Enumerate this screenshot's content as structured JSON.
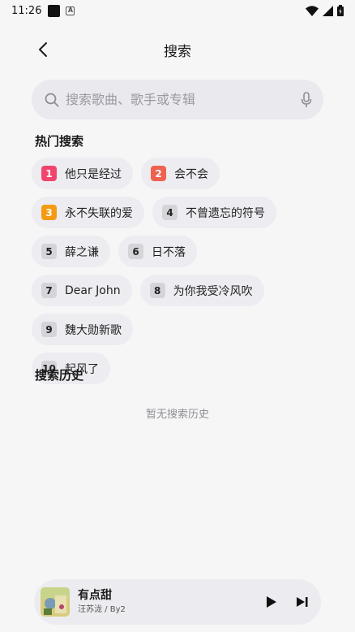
{
  "status_bar": {
    "time": "11:26"
  },
  "header": {
    "title": "搜索"
  },
  "search": {
    "placeholder": "搜索歌曲、歌手或专辑"
  },
  "hot_search": {
    "title": "热门搜索",
    "items": [
      {
        "rank": "1",
        "text": "他只是经过"
      },
      {
        "rank": "2",
        "text": "会不会"
      },
      {
        "rank": "3",
        "text": "永不失联的爱"
      },
      {
        "rank": "4",
        "text": "不曾遗忘的符号"
      },
      {
        "rank": "5",
        "text": "薛之谦"
      },
      {
        "rank": "6",
        "text": "日不落"
      },
      {
        "rank": "7",
        "text": "Dear John"
      },
      {
        "rank": "8",
        "text": "为你我受冷风吹"
      },
      {
        "rank": "9",
        "text": "魏大勋新歌"
      },
      {
        "rank": "10",
        "text": "起风了"
      }
    ]
  },
  "history": {
    "title": "搜索历史",
    "empty_text": "暂无搜索历史"
  },
  "player": {
    "title": "有点甜",
    "artist": "汪苏泷 / By2"
  },
  "colors": {
    "rank1": "#f2456e",
    "rank2": "#f0614f",
    "rank3": "#f39c12",
    "rank_default": "#d4d4d9"
  }
}
